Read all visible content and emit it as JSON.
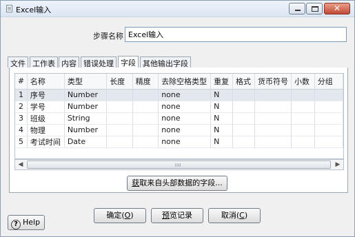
{
  "window": {
    "title": "Excel输入"
  },
  "step": {
    "label": "步骤名称",
    "value": "Excel输入"
  },
  "tabs": [
    "文件",
    "工作表",
    "内容",
    "错误处理",
    "字段",
    "其他输出字段"
  ],
  "fields_table": {
    "headers": [
      "#",
      "名称",
      "类型",
      "长度",
      "精度",
      "去除空格类型",
      "重复",
      "格式",
      "货币符号",
      "小数",
      "分组"
    ],
    "rows": [
      [
        "1",
        "序号",
        "Number",
        "",
        "",
        "none",
        "N",
        "",
        "",
        "",
        ""
      ],
      [
        "2",
        "学号",
        "Number",
        "",
        "",
        "none",
        "N",
        "",
        "",
        "",
        ""
      ],
      [
        "3",
        "班级",
        "String",
        "",
        "",
        "none",
        "N",
        "",
        "",
        "",
        ""
      ],
      [
        "4",
        "物理",
        "Number",
        "",
        "",
        "none",
        "N",
        "",
        "",
        "",
        ""
      ],
      [
        "5",
        "考试时间",
        "Date",
        "",
        "",
        "none",
        "N",
        "",
        "",
        "",
        ""
      ]
    ]
  },
  "buttons": {
    "get_fields": {
      "key": "获",
      "rest": "取来自头部数据的字段..."
    },
    "ok": {
      "text": "确定(",
      "key": "O",
      "end": ")"
    },
    "preview": {
      "key": "预",
      "rest": "览记录"
    },
    "cancel": {
      "text": "取消(",
      "key": "C",
      "end": ")"
    },
    "help": "Help"
  },
  "scrollbar": {
    "grip": "III"
  },
  "window_controls": {
    "close": "✕"
  }
}
